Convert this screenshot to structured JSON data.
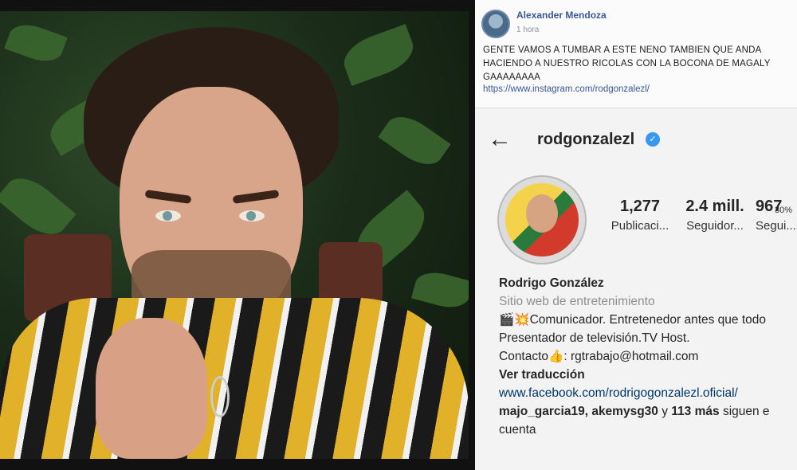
{
  "facebook_post": {
    "author": "Alexander Mendoza",
    "time": "1 hora",
    "text_line1": "GENTE VAMOS A TUMBAR A ESTE NENO TAMBIEN QUE ANDA",
    "text_line2": "HACIENDO A NUESTRO RICOLAS CON LA BOCONA DE MAGALY",
    "text_line3": "GAAAAAAAA",
    "link": "https://www.instagram.com/rodgonzalezl/"
  },
  "status_bar": {
    "battery": "30%"
  },
  "instagram": {
    "back_icon": "back-arrow-icon",
    "username": "rodgonzalezl",
    "verified_icon": "verified-badge-icon",
    "stats": [
      {
        "value": "1,277",
        "label": "Publicaci..."
      },
      {
        "value": "2.4 mill.",
        "label": "Seguidor..."
      },
      {
        "value": "967",
        "label": "Segui..."
      }
    ],
    "bio": {
      "name": "Rodrigo González",
      "category": "Sitio web de entretenimiento",
      "line1": "🎬💥Comunicador. Entretenedor antes que todo",
      "line2": "Presentador de televisión.TV Host.",
      "line3": "Contacto👍: rgtrabajo@hotmail.com",
      "translate": "Ver traducción",
      "link": "www.facebook.com/rodrigogonzalezl.oficial/",
      "followed_by_users": "majo_garcia19, akemysg30",
      "followed_by_connector": " y ",
      "followed_by_more": "113 más",
      "followed_by_suffix": " siguen e",
      "followed_by_line2": "cuenta"
    }
  },
  "colors": {
    "facebook_blue": "#385898",
    "instagram_verified": "#3897f0",
    "link_blue": "#00376b"
  }
}
